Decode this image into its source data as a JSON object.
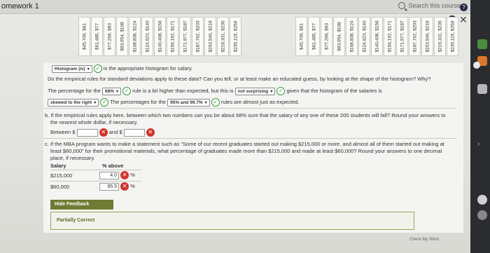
{
  "window": {
    "title": "omework 1",
    "search_label": "Search this course",
    "help": "?",
    "info": "i",
    "close": "✕"
  },
  "histogram_labels_a": [
    "$45,700, $61",
    "$61,485, $77",
    "$77,269, $93",
    "$93,054, $108",
    "$108,838, $124",
    "$124,623, $140",
    "$140,408, $156",
    "$156,192, $171",
    "$171,977, $187",
    "$187,762, $203",
    "$203,546, $219",
    "$219,331, $235",
    "$235,115, $250"
  ],
  "histogram_labels_b": [
    "$45,700, $61",
    "$61,485, $77",
    "$77,269, $93",
    "$93,054, $108",
    "$108,838, $124",
    "$124,623, $140",
    "$140,408, $156",
    "$156,192, $171",
    "$171,977, $187",
    "$187,762, $203",
    "$203,546, $219",
    "$219,331, $235",
    "$235,115, $250"
  ],
  "question": {
    "histogram_select": "Histogram (iv)",
    "histogram_tail": "is the appropriate histogram for salary.",
    "empirical_q": "Do the empirical rules for standard deviations apply to these data? Can you tell, or at least make an educated guess, by looking at the shape of the histogram? Why?",
    "line1_a": "The percentage for the",
    "line1_sel1": "68%",
    "line1_b": "rule is a bit higher than expected, but this is",
    "line1_sel2": "not surprising",
    "line1_c": "given that the histogram of the salaries is",
    "line2_sel": "skewed to the right",
    "line2_a": "The percentages for the",
    "line2_sel2": "95% and 99.7%",
    "line2_b": "rules are almost just as expected.",
    "b_text": "b. If the empirical rules apply here, between which two numbers can you be about 68% sure that the salary of any one of these 200 students will fall? Round your answers to",
    "b_text2": "the nearest whole dollar, if necessary.",
    "between": "Between",
    "dollar": "$",
    "and": "and $",
    "c_text": "c. If the MBA program wants to make a statement such as \"Some of our recent graduates started out making $215,000 or more, and almost all of them started out making at",
    "c_text2": "least $60,000\" for their promotional materials, what percentage of graduates made more than $215,000 and made at least $60,000? Round your answers to one decimal",
    "c_text3": "place, if necessary.",
    "col_salary": "Salary",
    "col_above": "% above",
    "rows": [
      {
        "salary": "$215,000",
        "value": "4.0",
        "unit": "%"
      },
      {
        "salary": "$60,000",
        "value": "95.5",
        "unit": "%"
      }
    ]
  },
  "feedback": {
    "hide_label": "Hide Feedback",
    "status": "Partially Correct"
  },
  "footer": {
    "check_work": "Check My Work"
  }
}
